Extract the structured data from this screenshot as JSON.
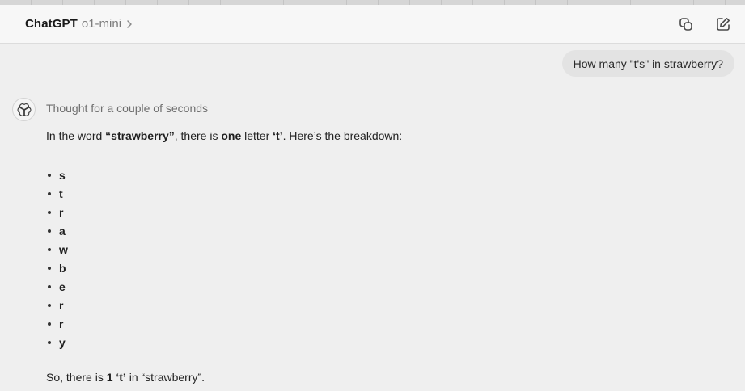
{
  "header": {
    "app_name": "ChatGPT",
    "model": "o1-mini",
    "icons": [
      "copy-icon",
      "edit-icon"
    ]
  },
  "user_message": "How many \"t's\" in strawberry?",
  "assistant": {
    "thought": "Thought for a couple of seconds",
    "intro": {
      "pre": "In the word ",
      "word": "“strawberry”",
      "mid1": ", there is ",
      "count_word": "one",
      "mid2": " letter ",
      "letter": "‘t’",
      "post": ". Here’s the breakdown:"
    },
    "letters": [
      "s",
      "t",
      "r",
      "a",
      "w",
      "b",
      "e",
      "r",
      "r",
      "y"
    ],
    "summary": {
      "pre": "So, there is ",
      "count": "1 ‘t’",
      "post": " in “strawberry”."
    }
  },
  "colors": {
    "background": "#efefef",
    "header": "#f7f7f7",
    "bubble": "#e3e3e3",
    "muted_text": "#6e6e6e"
  }
}
